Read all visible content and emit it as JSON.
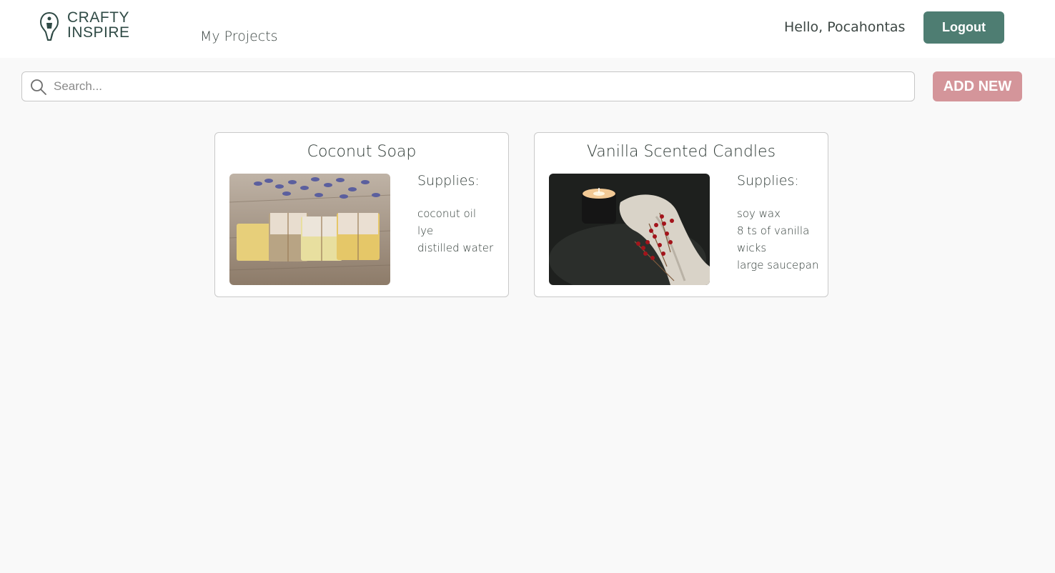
{
  "header": {
    "logo_line1": "CRAFTY",
    "logo_line2": "INSPIRE",
    "nav_my_projects": "My Projects",
    "greeting": "Hello, Pocahontas",
    "logout_label": "Logout"
  },
  "toolbar": {
    "search_placeholder": "Search...",
    "add_new_label": "ADD NEW"
  },
  "projects": [
    {
      "title": "Coconut Soap",
      "image": "soap-bars-lavender-photo",
      "supplies_heading": "Supplies:",
      "supplies": [
        "coconut oil",
        "lye",
        "distilled water"
      ]
    },
    {
      "title": "Vanilla Scented Candles",
      "image": "candle-berries-photo",
      "supplies_heading": "Supplies:",
      "supplies": [
        "soy wax",
        "8 ts of vanilla",
        "wicks",
        "large saucepan"
      ]
    }
  ],
  "colors": {
    "brand_green": "#4e7d72",
    "accent_pink": "#d4959a",
    "page_background": "#f9f9f9"
  }
}
